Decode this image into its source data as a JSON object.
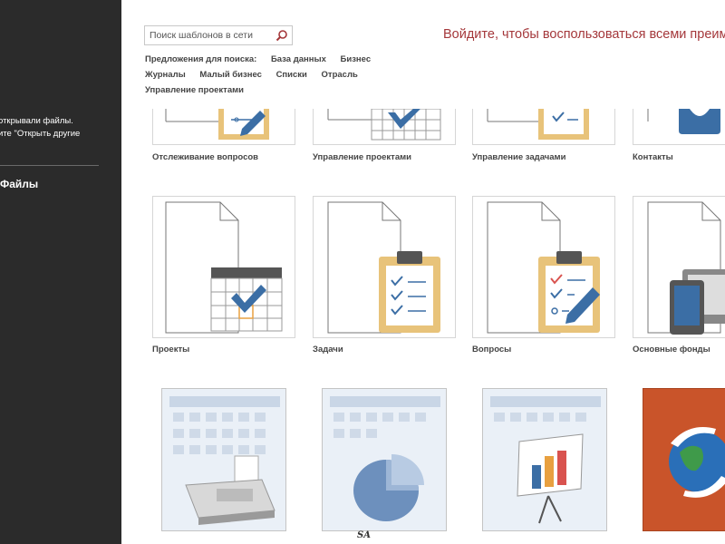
{
  "sidebar": {
    "recent_line1": "открывали файлы.",
    "recent_line2": "ите \"Открыть другие",
    "open_other_files": "Файлы"
  },
  "search": {
    "placeholder": "Поиск шаблонов в сети"
  },
  "signin_message": "Войдите, чтобы воспользоваться всеми преим",
  "suggestions": {
    "label": "Предложения для поиска:",
    "items": [
      "База данных",
      "Бизнес",
      "Журналы",
      "Малый бизнес",
      "Списки",
      "Отрасль",
      "Управление проектами"
    ]
  },
  "templates_row1": [
    {
      "label": "Отслеживание вопросов",
      "icon": "clipboard-pen-icon"
    },
    {
      "label": "Управление проектами",
      "icon": "calendar-check-icon"
    },
    {
      "label": "Управление задачами",
      "icon": "clipboard-check-icon"
    },
    {
      "label": "Контакты",
      "icon": "person-icon"
    }
  ],
  "templates_row2": [
    {
      "label": "Проекты",
      "icon": "calendar-check-icon"
    },
    {
      "label": "Задачи",
      "icon": "checklist-clipboard-icon"
    },
    {
      "label": "Вопросы",
      "icon": "clipboard-pen-icon"
    },
    {
      "label": "Основные фонды",
      "icon": "devices-icon"
    }
  ],
  "templates_row3": [
    {
      "icon": "fax-machine-icon"
    },
    {
      "icon": "pie-chart-icon"
    },
    {
      "icon": "presentation-chart-icon"
    },
    {
      "icon": "globe-sync-icon"
    }
  ],
  "watermark": "SA",
  "colors": {
    "sidebar_bg": "#2b2b2b",
    "signin_text": "#a4373a",
    "accent_blue": "#3b6ea5",
    "clipboard_tan": "#e8c37a"
  }
}
